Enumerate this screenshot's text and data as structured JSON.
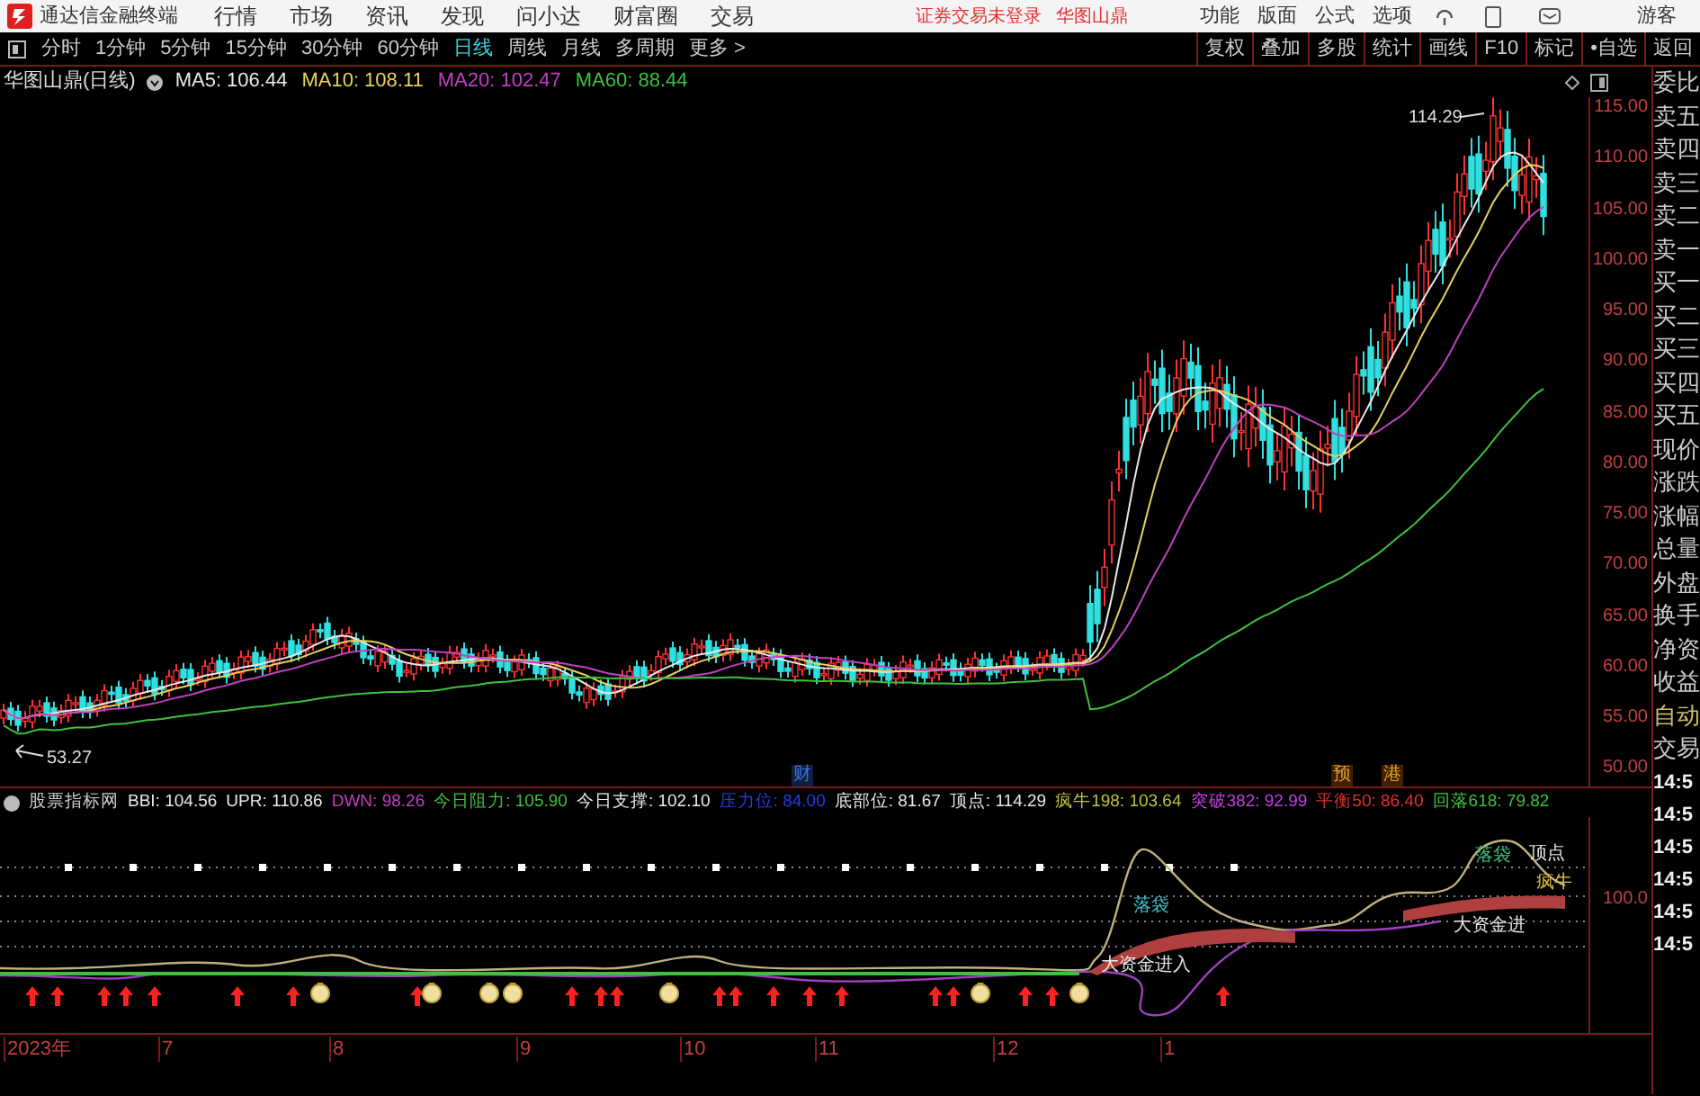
{
  "app": {
    "title": "通达信金融终端",
    "menus": [
      "行情",
      "市场",
      "资讯",
      "发现",
      "问小达",
      "财富圈",
      "交易"
    ],
    "notices": [
      "证券交易未登录",
      "华图山鼎"
    ],
    "right_menus": [
      "功能",
      "版面",
      "公式",
      "选项"
    ],
    "user": "游客"
  },
  "periods": [
    {
      "label": "分时",
      "selected": false
    },
    {
      "label": "1分钟",
      "selected": false
    },
    {
      "label": "5分钟",
      "selected": false
    },
    {
      "label": "15分钟",
      "selected": false
    },
    {
      "label": "30分钟",
      "selected": false
    },
    {
      "label": "60分钟",
      "selected": false
    },
    {
      "label": "日线",
      "selected": true
    },
    {
      "label": "周线",
      "selected": false
    },
    {
      "label": "月线",
      "selected": false
    },
    {
      "label": "多周期",
      "selected": false
    },
    {
      "label": "更多 >",
      "selected": false
    }
  ],
  "tools": [
    "复权",
    "叠加",
    "多股",
    "统计",
    "画线",
    "F10",
    "标记",
    "•自选",
    "返回"
  ],
  "chart": {
    "title": "华图山鼎(日线)",
    "ma": [
      {
        "label": "MA5: 106.44",
        "color": "#e8e8e8"
      },
      {
        "label": "MA10: 108.11",
        "color": "#e8d060"
      },
      {
        "label": "MA20: 102.47",
        "color": "#c040c0"
      },
      {
        "label": "MA60: 88.44",
        "color": "#40c040"
      }
    ],
    "price_ticks": [
      "115.00",
      "110.00",
      "105.00",
      "100.00",
      "95.00",
      "90.00",
      "85.00",
      "80.00",
      "75.00",
      "70.00",
      "65.00",
      "60.00",
      "55.00",
      "50.00"
    ],
    "high_label": "114.29",
    "low_label": "53.27",
    "events": [
      "财",
      "预",
      "港"
    ]
  },
  "indicator": {
    "name": "股票指标网",
    "values": [
      {
        "label": "BBI: 104.56",
        "color": "#e8e8e8"
      },
      {
        "label": "UPR: 110.86",
        "color": "#e8e8e8"
      },
      {
        "label": "DWN: 98.26",
        "color": "#c040c0"
      },
      {
        "label": "今日阻力: 105.90",
        "color": "#40c040"
      },
      {
        "label": "今日支撑: 102.10",
        "color": "#e8e8e8"
      },
      {
        "label": "压力位: 84.00",
        "color": "#2040e0"
      },
      {
        "label": "底部位: 81.67",
        "color": "#e8e8e8"
      },
      {
        "label": "顶点: 114.29",
        "color": "#e8e8e8"
      },
      {
        "label": "疯牛198: 103.64",
        "color": "#c0c040"
      },
      {
        "label": "突破382: 92.99",
        "color": "#c040e0"
      },
      {
        "label": "平衡50: 86.40",
        "color": "#e03030"
      },
      {
        "label": "回落618: 79.82",
        "color": "#40c040"
      }
    ],
    "signals": [
      {
        "text": "落袋",
        "color": "#40c0d0"
      },
      {
        "text": "大资金进入",
        "color": "#e8e8e8"
      },
      {
        "text": "落袋",
        "color": "#40c080"
      },
      {
        "text": "顶点",
        "color": "#e8e8e8"
      },
      {
        "text": "大资金进",
        "color": "#e8e8e8"
      },
      {
        "text": "疯牛",
        "color": "#e0c040"
      }
    ],
    "axis_tick": "100.0"
  },
  "dates": [
    "2023年",
    "7",
    "8",
    "9",
    "10",
    "11",
    "12",
    "1"
  ],
  "side_panel": {
    "labels": [
      "委比",
      "卖五",
      "卖四",
      "卖三",
      "卖二",
      "卖一",
      "买一",
      "买二",
      "买三",
      "买四",
      "买五",
      "现价",
      "涨跌",
      "涨幅",
      "总量",
      "外盘",
      "换手",
      "净资",
      "收益"
    ],
    "auto": "自动",
    "trade": "交易",
    "times": [
      "14:5",
      "14:5",
      "14:5",
      "14:5",
      "14:5",
      "14:5"
    ]
  }
}
